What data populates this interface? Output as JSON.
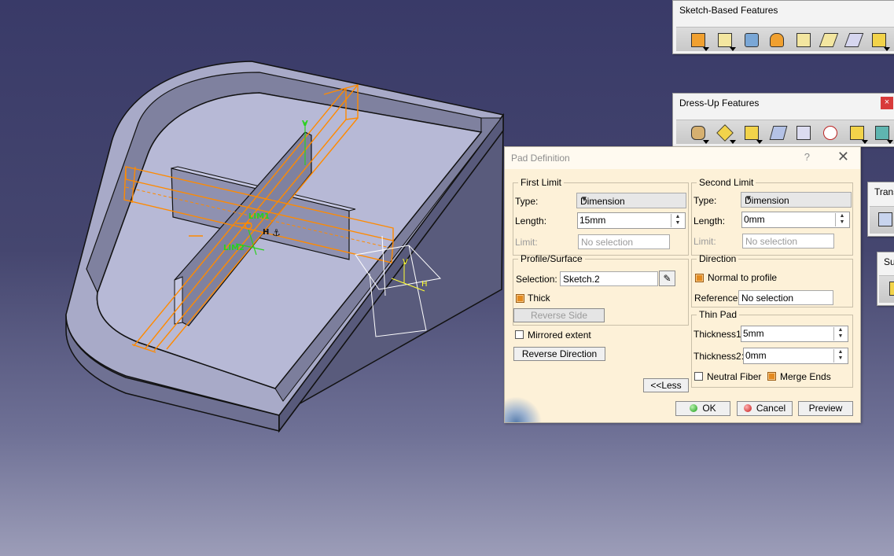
{
  "toolbars": {
    "sketch_based": {
      "title": "Sketch-Based Features",
      "icons": [
        "pad-icon",
        "pocket-icon",
        "shaft-icon",
        "groove-icon",
        "hole-icon",
        "rib-icon",
        "slot-icon",
        "multi-section-solid-icon"
      ]
    },
    "dress_up": {
      "title": "Dress-Up Features",
      "close": "×",
      "icons": [
        "edge-fillet-icon",
        "chamfer-icon",
        "draft-icon",
        "shell-icon",
        "thickness-icon",
        "thread-icon",
        "remove-face-icon",
        "replace-face-icon"
      ]
    },
    "trans": {
      "title": "Trans"
    },
    "su": {
      "title": "Su"
    }
  },
  "viewport": {
    "annotations": [
      "LIM1",
      "LIM2",
      "H",
      "V",
      "H"
    ]
  },
  "dialog": {
    "title": "Pad Definition",
    "help": "?",
    "close": "✕",
    "first_limit": {
      "legend": "First Limit",
      "type_label": "Type:",
      "type_value": "Dimension",
      "length_label": "Length:",
      "length_value": "15mm",
      "limit_label": "Limit:",
      "limit_value": "No selection"
    },
    "second_limit": {
      "legend": "Second Limit",
      "type_label": "Type:",
      "type_value": "Dimension",
      "length_label": "Length:",
      "length_value": "0mm",
      "limit_label": "Limit:",
      "limit_value": "No selection"
    },
    "profile": {
      "legend": "Profile/Surface",
      "selection_label": "Selection:",
      "selection_value": "Sketch.2",
      "thick_label": "Thick",
      "thick_checked": true,
      "reverse_side": "Reverse Side"
    },
    "mirrored_label": "Mirrored extent",
    "mirrored_checked": false,
    "reverse_direction": "Reverse Direction",
    "direction": {
      "legend": "Direction",
      "normal_label": "Normal to profile",
      "normal_checked": true,
      "reference_label": "Reference:",
      "reference_value": "No selection"
    },
    "thin_pad": {
      "legend": "Thin Pad",
      "thickness1_label": "Thickness1",
      "thickness1_value": "5mm",
      "thickness2_label": "Thickness2:",
      "thickness2_value": "0mm",
      "neutral_label": "Neutral Fiber",
      "neutral_checked": false,
      "merge_label": "Merge Ends",
      "merge_checked": true
    },
    "less_button": "<<Less",
    "ok": "OK",
    "cancel": "Cancel",
    "preview": "Preview"
  }
}
